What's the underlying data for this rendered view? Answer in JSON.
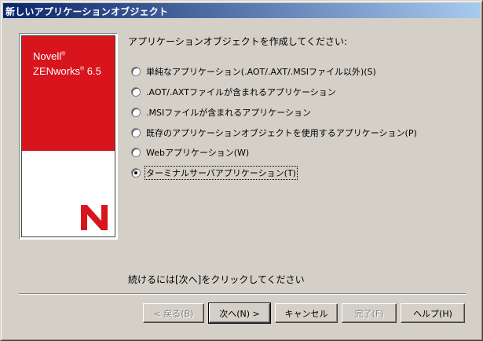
{
  "window": {
    "title": "新しいアプリケーションオブジェクト"
  },
  "banner": {
    "brand_line1": "Novell",
    "brand_line2": "ZENworks",
    "version": "6.5",
    "registered_mark": "®",
    "logo_letter": "N",
    "colors": {
      "red": "#d8141c",
      "white": "#ffffff"
    }
  },
  "heading": "アプリケーションオブジェクトを作成してください:",
  "options": [
    {
      "label": "単純なアプリケーション(.AOT/.AXT/.MSIファイル以外)(S)",
      "checked": false
    },
    {
      "label": ".AOT/.AXTファイルが含まれるアプリケーション",
      "checked": false
    },
    {
      "label": ".MSIファイルが含まれるアプリケーション",
      "checked": false
    },
    {
      "label": "既存のアプリケーションオブジェクトを使用するアプリケーション(P)",
      "checked": false
    },
    {
      "label": "Webアプリケーション(W)",
      "checked": false
    },
    {
      "label": "ターミナルサーバアプリケーション(T)",
      "checked": true
    }
  ],
  "hint": "続けるには[次へ]をクリックしてください",
  "buttons": {
    "back": "< 戻る(B)",
    "next": "次へ(N) >",
    "cancel": "キャンセル",
    "finish": "完了(F)",
    "help": "ヘルプ(H)"
  },
  "colors": {
    "title_gradient_start": "#0a246a",
    "title_gradient_end": "#a6caf0",
    "face": "#d4d0c8"
  }
}
